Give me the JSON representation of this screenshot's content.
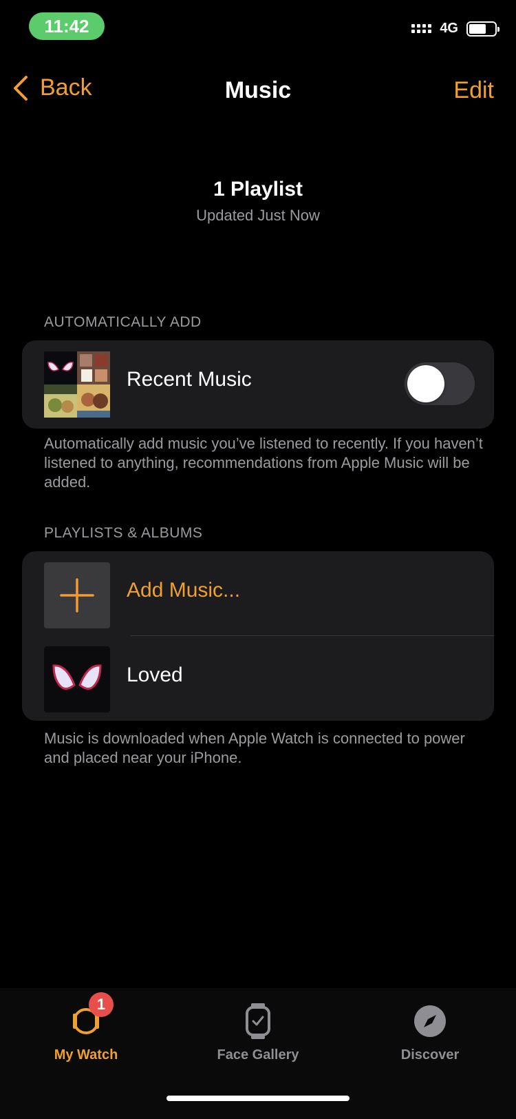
{
  "status_bar": {
    "time": "11:42",
    "network": "4G"
  },
  "nav": {
    "back_label": "Back",
    "title": "Music",
    "edit_label": "Edit"
  },
  "summary": {
    "title": "1 Playlist",
    "subtitle": "Updated Just Now"
  },
  "auto_add": {
    "header": "AUTOMATICALLY ADD",
    "row_label": "Recent Music",
    "toggle_on": false,
    "footnote": "Automatically add music you’ve listened to recently. If you haven’t listened to anything, recommendations from Apple Music will be added."
  },
  "playlists": {
    "header": "PLAYLISTS & ALBUMS",
    "add_label": "Add Music...",
    "items": [
      {
        "label": "Loved"
      }
    ],
    "footnote": "Music is downloaded when Apple Watch is connected to power and placed near your iPhone."
  },
  "tabbar": {
    "tabs": [
      {
        "label": "My Watch",
        "icon": "watch-icon",
        "badge": "1",
        "active": true
      },
      {
        "label": "Face Gallery",
        "icon": "watch-face-icon",
        "active": false
      },
      {
        "label": "Discover",
        "icon": "compass-icon",
        "active": false
      }
    ]
  },
  "colors": {
    "accent": "#f0a033",
    "background": "#000000",
    "card": "#1c1c1e",
    "secondary_text": "#9b9ba0",
    "badge": "#e84e4b"
  }
}
